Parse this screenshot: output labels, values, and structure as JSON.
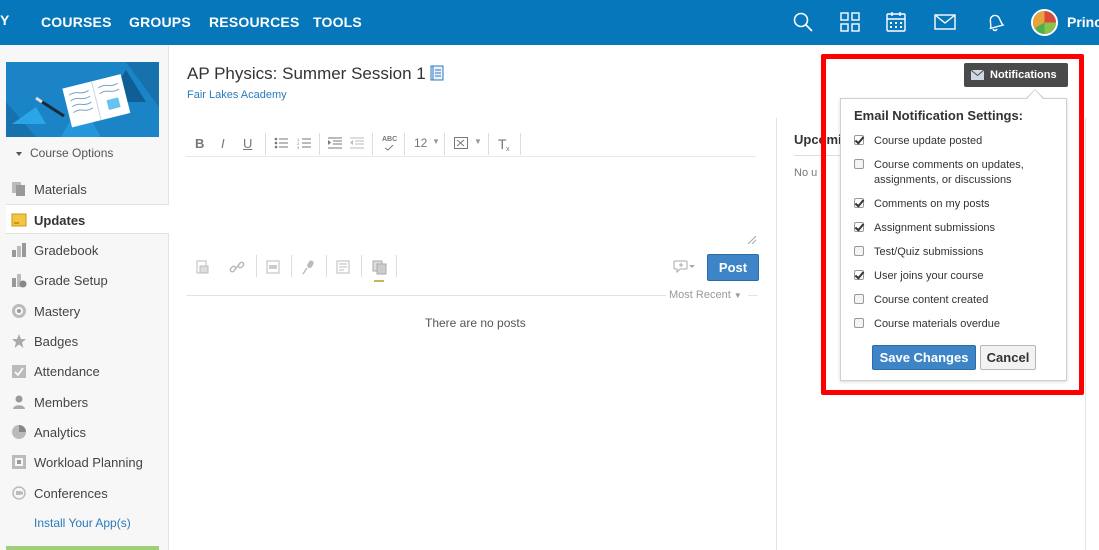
{
  "topnav": {
    "logo_fragment": "Y",
    "links": [
      "COURSES",
      "GROUPS",
      "RESOURCES",
      "TOOLS"
    ],
    "icons": [
      "search-icon",
      "apps-grid-icon",
      "calendar-icon",
      "mail-icon",
      "bell-icon"
    ],
    "user_name": "Princ"
  },
  "sidebar": {
    "course_options": "Course Options",
    "items": [
      {
        "label": "Materials",
        "icon": "materials-icon"
      },
      {
        "label": "Updates",
        "icon": "updates-icon",
        "active": true
      },
      {
        "label": "Gradebook",
        "icon": "gradebook-icon"
      },
      {
        "label": "Grade Setup",
        "icon": "grade-setup-icon"
      },
      {
        "label": "Mastery",
        "icon": "mastery-icon"
      },
      {
        "label": "Badges",
        "icon": "badges-icon"
      },
      {
        "label": "Attendance",
        "icon": "attendance-icon"
      },
      {
        "label": "Members",
        "icon": "members-icon"
      },
      {
        "label": "Analytics",
        "icon": "analytics-icon"
      },
      {
        "label": "Workload Planning",
        "icon": "workload-icon"
      },
      {
        "label": "Conferences",
        "icon": "conferences-icon"
      }
    ],
    "install_apps": "Install Your App(s)"
  },
  "main": {
    "course_title": "AP Physics: Summer Session 1",
    "school": "Fair Lakes Academy",
    "editor": {
      "bold": "B",
      "italic": "I",
      "underline": "U",
      "spellcheck": "ABC",
      "font_size": "12",
      "clear_format": "T",
      "post_label": "Post"
    },
    "sort_label": "Most Recent",
    "empty_message": "There are no posts"
  },
  "right_col": {
    "upcoming_title": "Upcomi",
    "no_upcoming": "No u"
  },
  "notifications": {
    "button_label": "Notifications",
    "title": "Email Notification Settings:",
    "options": [
      {
        "label": "Course update posted",
        "checked": true
      },
      {
        "label": "Course comments on updates, assignments, or discussions",
        "checked": false
      },
      {
        "label": "Comments on my posts",
        "checked": true
      },
      {
        "label": "Assignment submissions",
        "checked": true
      },
      {
        "label": "Test/Quiz submissions",
        "checked": false
      },
      {
        "label": "User joins your course",
        "checked": true
      },
      {
        "label": "Course content created",
        "checked": false
      },
      {
        "label": "Course materials overdue",
        "checked": false
      }
    ],
    "save_label": "Save Changes",
    "cancel_label": "Cancel"
  },
  "colors": {
    "nav_blue": "#0677ba",
    "button_blue": "#3d85c6",
    "highlight_red": "#ff0000",
    "link_blue": "#2a7bbd"
  }
}
